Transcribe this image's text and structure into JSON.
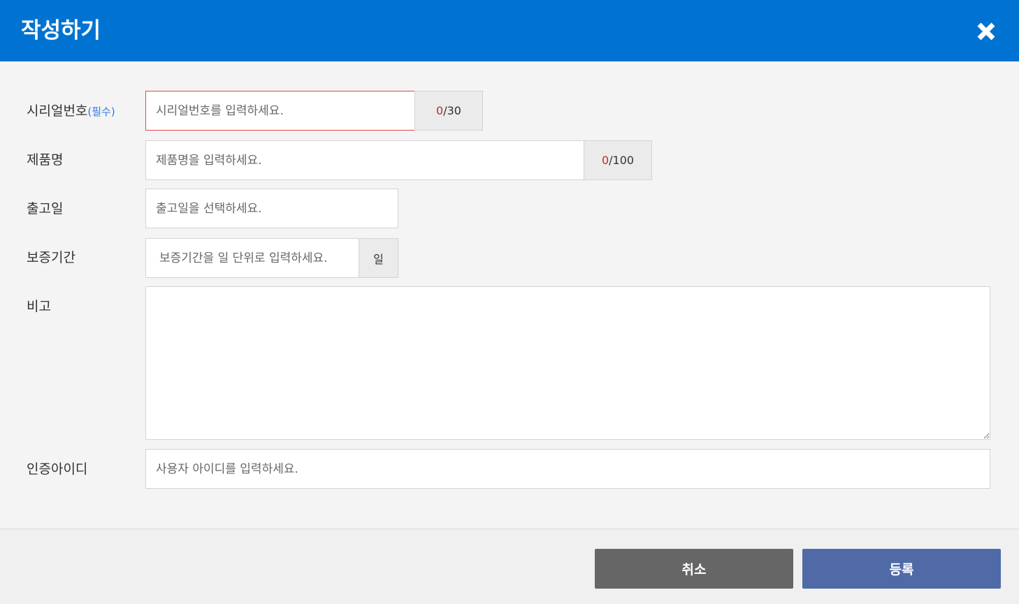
{
  "header": {
    "title": "작성하기"
  },
  "fields": {
    "serial": {
      "label": "시리얼번호",
      "required": "(필수)",
      "placeholder": "시리얼번호를 입력하세요.",
      "count": "0",
      "max": "/30"
    },
    "product": {
      "label": "제품명",
      "placeholder": "제품명을 입력하세요.",
      "count": "0",
      "max": "/100"
    },
    "release_date": {
      "label": "출고일",
      "placeholder": "출고일을 선택하세요."
    },
    "warranty": {
      "label": "보증기간",
      "placeholder": "보증기간을 일 단위로 입력하세요.",
      "unit": "일"
    },
    "memo": {
      "label": "비고"
    },
    "auth_id": {
      "label": "인증아이디",
      "placeholder": "사용자 아이디를 입력하세요."
    }
  },
  "footer": {
    "cancel_label": "취소",
    "submit_label": "등록"
  },
  "colors": {
    "header_bg": "#0073d2",
    "error_border": "#e04848",
    "required_text": "#2f7bd8",
    "cancel_bg": "#666666",
    "submit_bg": "#4f6aa7"
  },
  "icons": {
    "close": "close-icon"
  }
}
